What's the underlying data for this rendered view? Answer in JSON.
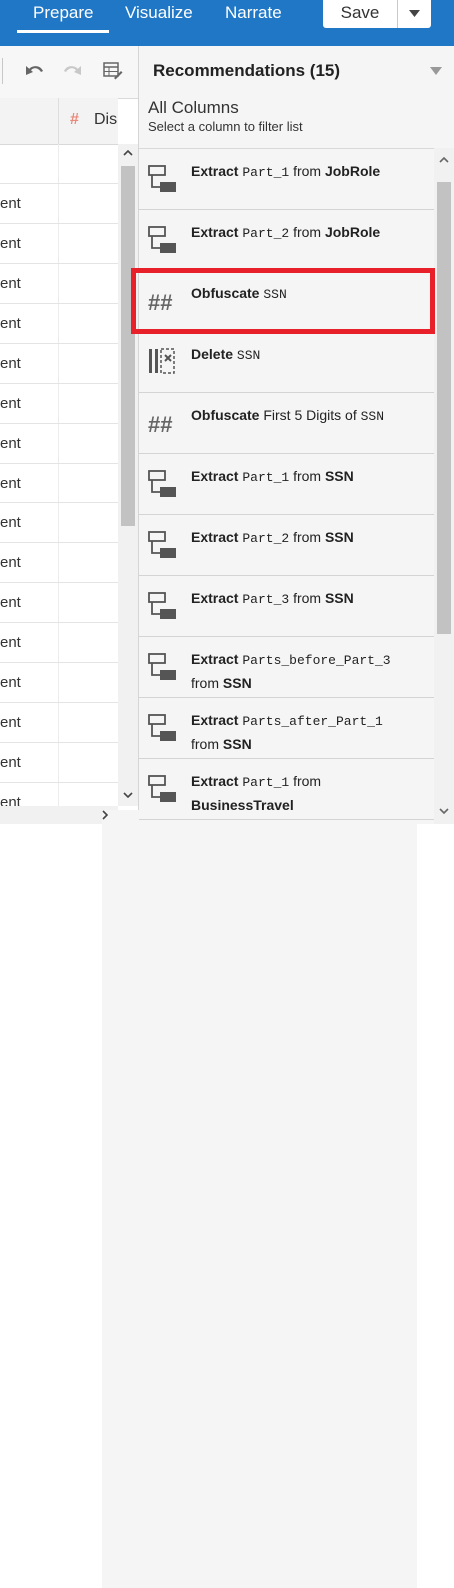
{
  "tabs": [
    {
      "label": "Prepare",
      "active": true
    },
    {
      "label": "Visualize",
      "active": false
    },
    {
      "label": "Narrate",
      "active": false
    }
  ],
  "save_label": "Save",
  "colors": {
    "brand": "#1f77c5",
    "highlight": "#e8202a",
    "measure_icon": "#e9897a"
  },
  "grid": {
    "column_header": "Dis",
    "column_header_icon": "hash-icon",
    "rows": [
      "ent",
      "ent",
      "ent",
      "ent",
      "ent",
      "ent",
      "ent",
      "ent",
      "ent",
      "ent",
      "ent",
      "ent",
      "ent",
      "ent",
      "ent",
      "ent"
    ]
  },
  "panel": {
    "title": "Recommendations (15)",
    "section_title": "All Columns",
    "section_subtitle": "Select a column to filter list",
    "items": [
      {
        "icon": "extract-icon",
        "action": "Extract",
        "arg": "Part_1",
        "connector": "from",
        "target": "JobRole"
      },
      {
        "icon": "extract-icon",
        "action": "Extract",
        "arg": "Part_2",
        "connector": "from",
        "target": "JobRole"
      },
      {
        "icon": "obfuscate-icon",
        "action": "Obfuscate",
        "arg": "SSN",
        "highlighted": true
      },
      {
        "icon": "delete-column-icon",
        "action": "Delete",
        "arg": "SSN"
      },
      {
        "icon": "obfuscate-icon",
        "action": "Obfuscate",
        "prefix": "First 5 Digits of",
        "arg": "SSN"
      },
      {
        "icon": "extract-icon",
        "action": "Extract",
        "arg": "Part_1",
        "connector": "from",
        "target": "SSN"
      },
      {
        "icon": "extract-icon",
        "action": "Extract",
        "arg": "Part_2",
        "connector": "from",
        "target": "SSN"
      },
      {
        "icon": "extract-icon",
        "action": "Extract",
        "arg": "Part_3",
        "connector": "from",
        "target": "SSN"
      },
      {
        "icon": "extract-icon",
        "action": "Extract",
        "arg": "Parts_before_Part_3",
        "connector": "from",
        "target": "SSN"
      },
      {
        "icon": "extract-icon",
        "action": "Extract",
        "arg": "Parts_after_Part_1",
        "connector": "from",
        "target": "SSN"
      },
      {
        "icon": "extract-icon",
        "action": "Extract",
        "arg": "Part_1",
        "connector": "from",
        "target": "BusinessTravel"
      }
    ]
  }
}
